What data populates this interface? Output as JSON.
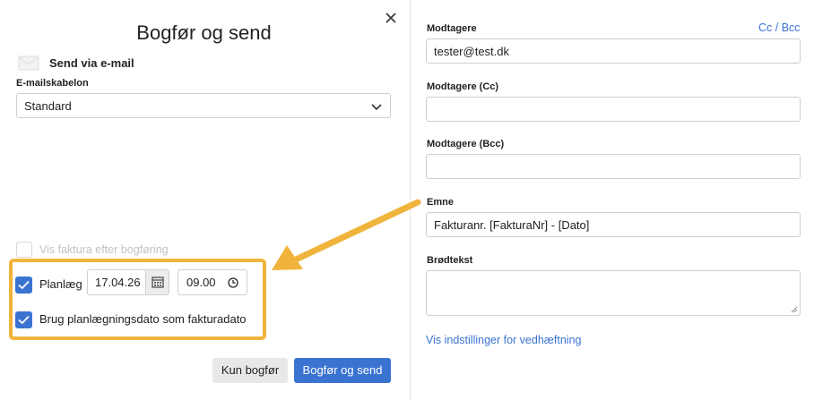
{
  "dialog": {
    "title": "Bogfør og send",
    "close_icon": "close-icon"
  },
  "left": {
    "send_label": "Send via e-mail",
    "mail_icon": "mail-icon",
    "template_label": "E-mailskabelon",
    "template_value": "Standard",
    "show_invoice_label": "Vis faktura efter bogføring",
    "show_invoice_checked": false,
    "schedule": {
      "label": "Planlæg",
      "checked": true,
      "date": "17.04.26",
      "time": "09.00"
    },
    "use_date_label": "Brug planlægningsdato som fakturadato",
    "use_date_checked": true,
    "highlight_color": "#f0b43c"
  },
  "buttons": {
    "post_only": "Kun bogfør",
    "post_send": "Bogfør og send"
  },
  "right": {
    "cc_bcc_link": "Cc / Bcc",
    "recipients_label": "Modtagere",
    "recipients_value": "tester@test.dk",
    "cc_label": "Modtagere (Cc)",
    "cc_value": "",
    "bcc_label": "Modtagere (Bcc)",
    "bcc_value": "",
    "subject_label": "Emne",
    "subject_value": "Fakturanr. [FakturaNr] - [Dato]",
    "body_label": "Brødtekst",
    "body_value": "",
    "attachment_link": "Vis indstillinger for vedhæftning"
  },
  "colors": {
    "accent": "#3b73d1",
    "arrow": "#f0b43c"
  }
}
